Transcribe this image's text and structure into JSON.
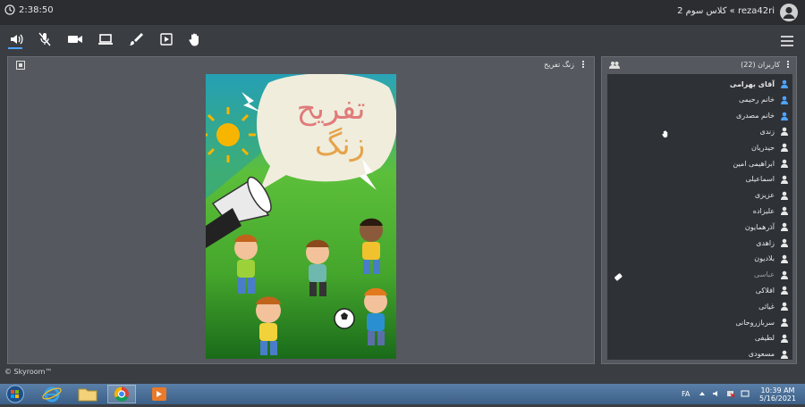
{
  "header": {
    "timer": "2:38:50",
    "room": "reza42ri » کلاس سوم 2"
  },
  "main_panel": {
    "title": "زنگ تفریح",
    "poster_title_line1": "تفریح",
    "poster_title_line2": "زنگ"
  },
  "users_panel": {
    "title": "کاربران (22)",
    "users": [
      {
        "name": "آقای بهرامی",
        "bold": true
      },
      {
        "name": "خانم رحیمی"
      },
      {
        "name": "خانم مصدری"
      },
      {
        "name": "زندی"
      },
      {
        "name": "حیدریان"
      },
      {
        "name": "ابراهیمی امین"
      },
      {
        "name": "اسماعیلی"
      },
      {
        "name": "عزیزی"
      },
      {
        "name": "علیزاده"
      },
      {
        "name": "آذرهمایون"
      },
      {
        "name": "زاهدی"
      },
      {
        "name": "بلادیون"
      },
      {
        "name": "عباسی",
        "muted": true
      },
      {
        "name": "افلاکی"
      },
      {
        "name": "غیاثی"
      },
      {
        "name": "سربازروحانی"
      },
      {
        "name": "لطیفی"
      },
      {
        "name": "مسعودی"
      }
    ]
  },
  "footer": {
    "copyright": "© Skyroom™"
  },
  "taskbar": {
    "lang": "FA",
    "time": "10:39 AM",
    "date": "5/16/2021"
  },
  "colors": {
    "accent": "#4ea3ff",
    "panel": "#55585e",
    "list_bg": "#2e3136"
  }
}
